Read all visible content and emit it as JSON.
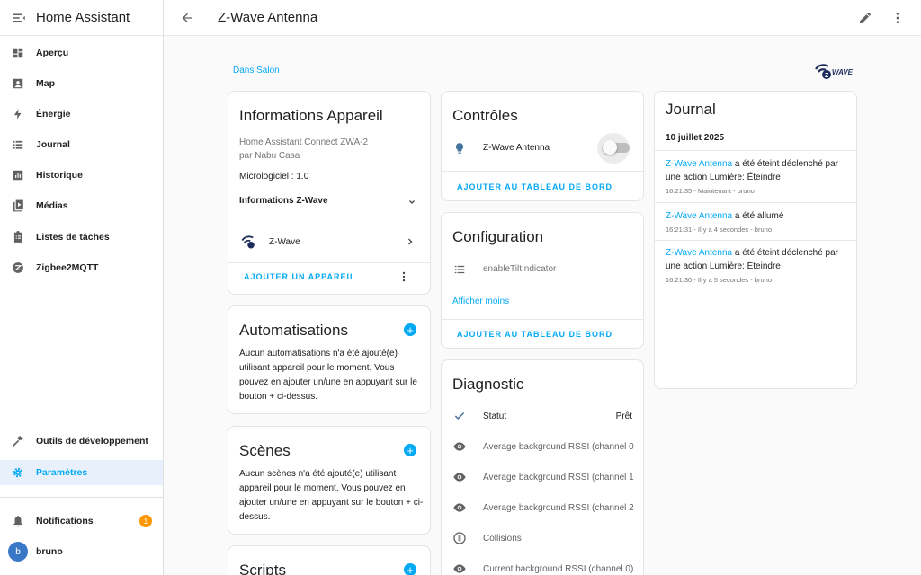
{
  "sidebar": {
    "title": "Home Assistant",
    "items": [
      {
        "label": "Aperçu",
        "icon": "dashboard-icon"
      },
      {
        "label": "Map",
        "icon": "map-icon"
      },
      {
        "label": "Énergie",
        "icon": "lightning-icon"
      },
      {
        "label": "Journal",
        "icon": "list-icon"
      },
      {
        "label": "Historique",
        "icon": "chart-icon"
      },
      {
        "label": "Médias",
        "icon": "media-icon"
      },
      {
        "label": "Listes de tâches",
        "icon": "clipboard-icon"
      },
      {
        "label": "Zigbee2MQTT",
        "icon": "zigbee-icon"
      }
    ],
    "dev_tools": "Outils de développement",
    "settings": "Paramètres",
    "notifications": "Notifications",
    "notifications_count": "1",
    "user_initial": "b",
    "user_name": "bruno"
  },
  "topbar": {
    "title": "Z-Wave Antenna"
  },
  "breadcrumb": "Dans Salon",
  "logo_text": "WAVE",
  "device_info": {
    "title": "Informations Appareil",
    "model": "Home Assistant Connect ZWA-2",
    "manufacturer": "par Nabu Casa",
    "firmware": "Micrologiciel : 1.0",
    "zwave_section": "Informations Z-Wave",
    "integration": "Z-Wave",
    "add_device": "AJOUTER UN APPAREIL"
  },
  "automations": {
    "title": "Automatisations",
    "text": "Aucun automatisations n'a été ajouté(e) utilisant appareil pour le moment. Vous pouvez en ajouter un/une en appuyant sur le bouton + ci-dessus."
  },
  "scenes": {
    "title": "Scènes",
    "text": "Aucun scènes n'a été ajouté(e) utilisant appareil pour le moment. Vous pouvez en ajouter un/une en appuyant sur le bouton + ci-dessus."
  },
  "scripts": {
    "title": "Scripts"
  },
  "controls": {
    "title": "Contrôles",
    "entity": "Z-Wave Antenna",
    "toggle_on": false,
    "add_dashboard": "AJOUTER AU TABLEAU DE BORD"
  },
  "configuration": {
    "title": "Configuration",
    "entity": "enableTiltIndicator",
    "show_less": "Afficher moins",
    "add_dashboard": "AJOUTER AU TABLEAU DE BORD"
  },
  "diagnostic": {
    "title": "Diagnostic",
    "rows": [
      {
        "label": "Statut",
        "value": "Prêt",
        "icon": "check-icon"
      },
      {
        "label": "Average background RSSI (channel 0",
        "value": "",
        "icon": "eye-icon"
      },
      {
        "label": "Average background RSSI (channel 1",
        "value": "",
        "icon": "eye-icon"
      },
      {
        "label": "Average background RSSI (channel 2",
        "value": "",
        "icon": "eye-icon"
      },
      {
        "label": "Collisions",
        "value": "",
        "icon": "alert-circle-icon"
      },
      {
        "label": "Current background RSSI (channel 0)",
        "value": "",
        "icon": "eye-icon"
      }
    ]
  },
  "journal": {
    "title": "Journal",
    "date": "10 juillet 2025",
    "entries": [
      {
        "entity": "Z-Wave Antenna",
        "text": " a été éteint déclenché par une action Lumière: Éteindre",
        "meta": "16:21:35 - Maintenant - bruno"
      },
      {
        "entity": "Z-Wave Antenna",
        "text": " a été allumé",
        "meta": "16:21:31 - Il y a 4 secondes - bruno"
      },
      {
        "entity": "Z-Wave Antenna",
        "text": " a été éteint déclenché par une action Lumière: Éteindre",
        "meta": "16:21:30 - Il y a 5 secondes - bruno"
      }
    ]
  },
  "colors": {
    "accent": "#03a9f4",
    "badge": "#ff9800",
    "avatar": "#3a78c7"
  }
}
